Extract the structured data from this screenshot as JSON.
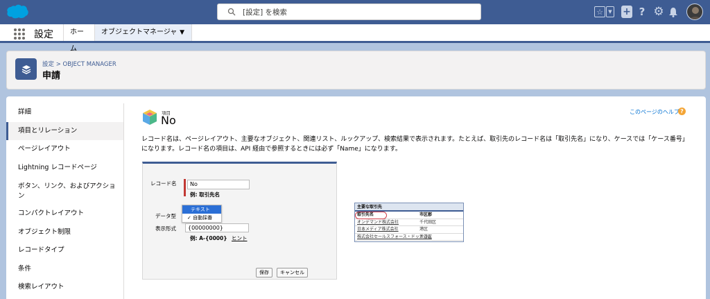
{
  "header": {
    "search_placeholder": "[設定] を検索"
  },
  "nav": {
    "app_name": "設定",
    "tabs": [
      {
        "label": "ホーム"
      },
      {
        "label": "オブジェクトマネージャ"
      }
    ]
  },
  "page_header": {
    "breadcrumb": "設定 > OBJECT MANAGER",
    "title": "申請"
  },
  "sidebar": {
    "items": [
      {
        "label": "詳細"
      },
      {
        "label": "項目とリレーション"
      },
      {
        "label": "ページレイアウト"
      },
      {
        "label": "Lightning レコードページ"
      },
      {
        "label": "ボタン、リンク、およびアクション"
      },
      {
        "label": "コンパクトレイアウト"
      },
      {
        "label": "オブジェクト制限"
      },
      {
        "label": "レコードタイプ"
      },
      {
        "label": "条件"
      },
      {
        "label": "検索レイアウト"
      }
    ],
    "active_index": 1
  },
  "content": {
    "field_type_label": "項目",
    "field_name": "No",
    "help_link": "このページのヘルプ",
    "description": "レコード名は、ページレイアウト、主要なオブジェクト、関連リスト、ルックアップ、検索結果で表示されます。たとえば、取引先のレコード名は「取引先名」になり、ケースでは「ケース番号」になります。レコード名の項目は、API 経由で参照するときには必ず「Name」になります。"
  },
  "example_form": {
    "record_name_label": "レコード名",
    "record_name_value": "No",
    "record_name_example": "例:  取引先名",
    "data_type_label": "データ型",
    "dropdown_options": [
      "テキスト",
      "自動採番"
    ],
    "dropdown_highlighted": "テキスト",
    "dropdown_checked": "自動採番",
    "display_format_label": "表示形式",
    "display_format_value": "{00000000}",
    "display_format_example": "例:  A-{0000}",
    "hint_link": "ヒント",
    "save_label": "保存",
    "cancel_label": "キャンセル"
  },
  "example_list": {
    "title": "主要な取引先",
    "columns": [
      "取引先名",
      "市区郡"
    ],
    "rows": [
      [
        "オンデマンド株式会社",
        "千代田区"
      ],
      [
        "日本メディア株式会社",
        "港区"
      ],
      [
        "株式会社セールスフォース・ドットコム",
        "渋谷区"
      ]
    ]
  },
  "colors": {
    "header_blue": "#3e5c93",
    "page_bg": "#b0c4df",
    "link": "#0070d2",
    "required_red": "#c23934"
  }
}
